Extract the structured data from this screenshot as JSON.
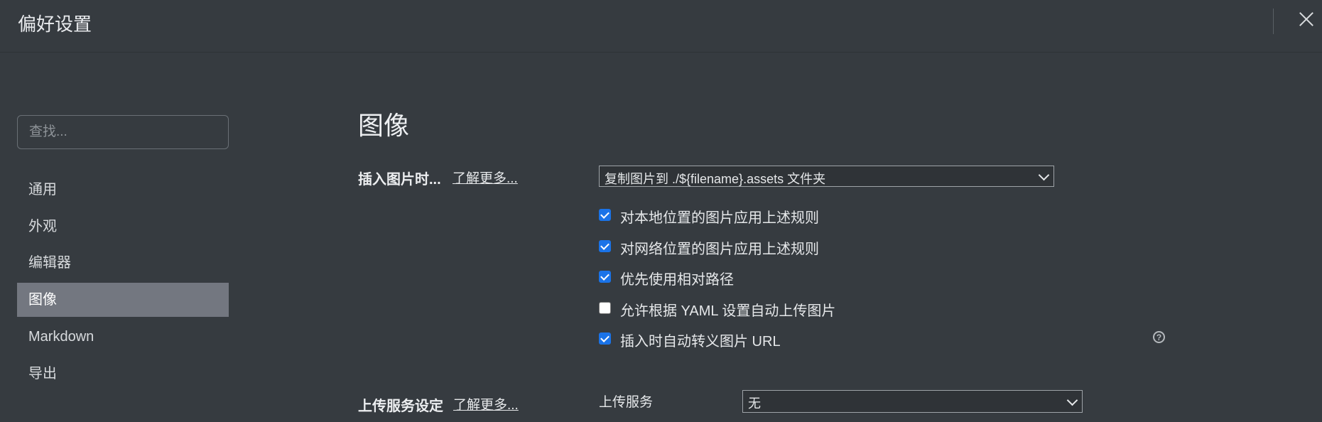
{
  "header": {
    "title": "偏好设置"
  },
  "sidebar": {
    "search_placeholder": "查找...",
    "items": [
      {
        "label": "通用",
        "active": false
      },
      {
        "label": "外观",
        "active": false
      },
      {
        "label": "编辑器",
        "active": false
      },
      {
        "label": "图像",
        "active": true
      },
      {
        "label": "Markdown",
        "active": false
      },
      {
        "label": "导出",
        "active": false
      }
    ]
  },
  "main": {
    "title": "图像",
    "insert": {
      "label": "插入图片时...",
      "learn_more": "了解更多...",
      "select_value": "复制图片到 ./${filename}.assets 文件夹",
      "options": [
        {
          "label": "对本地位置的图片应用上述规则",
          "checked": true
        },
        {
          "label": "对网络位置的图片应用上述规则",
          "checked": true
        },
        {
          "label": "优先使用相对路径",
          "checked": true
        },
        {
          "label": "允许根据 YAML 设置自动上传图片",
          "checked": false
        },
        {
          "label": "插入时自动转义图片 URL",
          "checked": true
        }
      ],
      "help_glyph": "?"
    },
    "upload": {
      "label": "上传服务设定",
      "learn_more": "了解更多...",
      "service_label": "上传服务",
      "service_value": "无"
    }
  }
}
